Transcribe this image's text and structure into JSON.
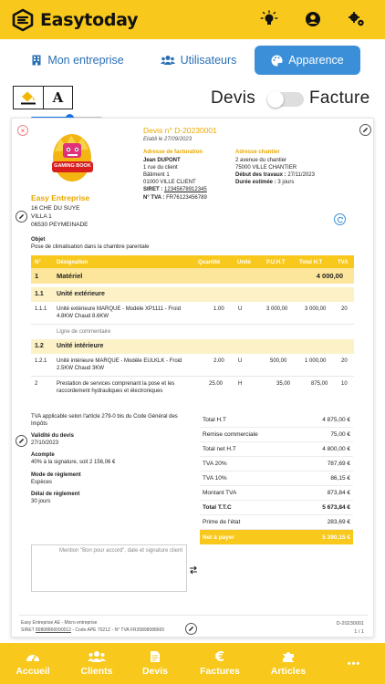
{
  "app": {
    "name": "Easytoday"
  },
  "tabs": [
    {
      "label": "Mon entreprise"
    },
    {
      "label": "Utilisateurs"
    },
    {
      "label": "Apparence"
    }
  ],
  "toolbar": {
    "text_style_glyph": "A",
    "devis_label": "Devis",
    "facture_label": "Facture",
    "mode_is_facture": false,
    "zoom_slider_fraction": 0.55
  },
  "doc": {
    "number": "Devis n° D-20230001",
    "date": "Etabli le 27/09/2023",
    "company": {
      "name": "Easy Entreprise",
      "lines": [
        "16 CHE DU SUYE",
        "VILLA 1",
        "06530 PEYMEINADE"
      ]
    },
    "logo": {
      "text": "GAMING BOOK"
    },
    "billing": {
      "title": "Adresse de facturation",
      "name": "Jean DUPONT",
      "lines": [
        "1 rue du client",
        "Bâtiment 1",
        "01000 VILLE CLIENT"
      ],
      "siret_label": "SIRET :",
      "siret": "12345678912345",
      "tva_label": "N° TVA :",
      "tva": "FR76123456789"
    },
    "site": {
      "title": "Adresse chantier",
      "lines": [
        "2 avenue du chantier",
        "75000 VILLE CHANTIER"
      ],
      "start_label": "Début des travaux :",
      "start": "27/11/2023",
      "duration_label": "Durée estimée :",
      "duration": "3 jours"
    },
    "object": {
      "label": "Objet",
      "text": "Pose de climatisation dans la chambre parentale"
    },
    "table": {
      "headers": [
        "N°",
        "Désignation",
        "Quantité",
        "Unité",
        "P.U.H.T",
        "Total H.T",
        "TVA"
      ],
      "rows": [
        {
          "kind": "section1",
          "num": "1",
          "label": "Matériel",
          "total": "4 000,00"
        },
        {
          "kind": "section2",
          "num": "1.1",
          "label": "Unité extérieure"
        },
        {
          "kind": "line",
          "num": "1.1.1",
          "label": "Unité extérieure MARQUE - Modèle XP1111 - Froid 4.8KW Chaud 8.6KW",
          "qty": "1.00",
          "unit": "U",
          "pu": "3 000,00",
          "total": "3 000,00",
          "tva": "20"
        },
        {
          "kind": "comment",
          "label": "Ligne de commentaire"
        },
        {
          "kind": "section2",
          "num": "1.2",
          "label": "Unité intérieure"
        },
        {
          "kind": "line",
          "num": "1.2.1",
          "label": "Unité intérieure MARQUE - Modèle EULKLK - Froid 2.5KW Chaud 3KW",
          "qty": "2.00",
          "unit": "U",
          "pu": "500,00",
          "total": "1 000,00",
          "tva": "20"
        },
        {
          "kind": "line",
          "num": "2",
          "label": "Prestation de services comprenant la pose et les raccordement hydrauliques et électroniques",
          "qty": "25.00",
          "unit": "H",
          "pu": "35,00",
          "total": "875,00",
          "tva": "10"
        }
      ]
    },
    "notes": {
      "tva_note": "TVA applicable selon l'article 279-0 bis du Code Général des Impôts",
      "validity_label": "Validité du devis",
      "validity": "27/10/2023",
      "deposit_label": "Acompte",
      "deposit": "40% à la signature, soit 2 156,06 €",
      "payment_label": "Mode de règlement",
      "payment": "Espèces",
      "delay_label": "Délai de règlement",
      "delay": "30 jours"
    },
    "totals": [
      {
        "label": "Total H.T",
        "value": "4 875,00 €"
      },
      {
        "label": "Remise commerciale",
        "value": "75,00 €"
      },
      {
        "label": "Total net H.T",
        "value": "4 800,00 €"
      },
      {
        "label": "TVA 20%",
        "value": "787,69 €"
      },
      {
        "label": "TVA 10%",
        "value": "86,15 €"
      },
      {
        "label": "Montant TVA",
        "value": "873,84 €"
      },
      {
        "label": "Total T.T.C",
        "value": "5 673,84 €"
      },
      {
        "label": "Prime de l'état",
        "value": "283,69 €"
      },
      {
        "label": "Net à payer",
        "value": "5 390,15 €"
      }
    ],
    "signature_placeholder": "Mention \"Bon pour accord\", date et signature client",
    "footer": {
      "company_line": "Easy Entreprise AE - Micro entreprise",
      "siret_prefix": "SIRET ",
      "siret": "89808866590012",
      "rest": " - Code APE 7021Z - N° TVA FR35898088665",
      "number": "D-20230001",
      "page": "1 / 1"
    }
  },
  "nav": [
    {
      "label": "Accueil"
    },
    {
      "label": "Clients"
    },
    {
      "label": "Devis"
    },
    {
      "label": "Factures"
    },
    {
      "label": "Articles"
    },
    {
      "label": "•••"
    }
  ],
  "colors": {
    "brand_yellow": "#F8C81C",
    "accent_blue": "#3B8FD9",
    "gold_text": "#E9A800"
  }
}
